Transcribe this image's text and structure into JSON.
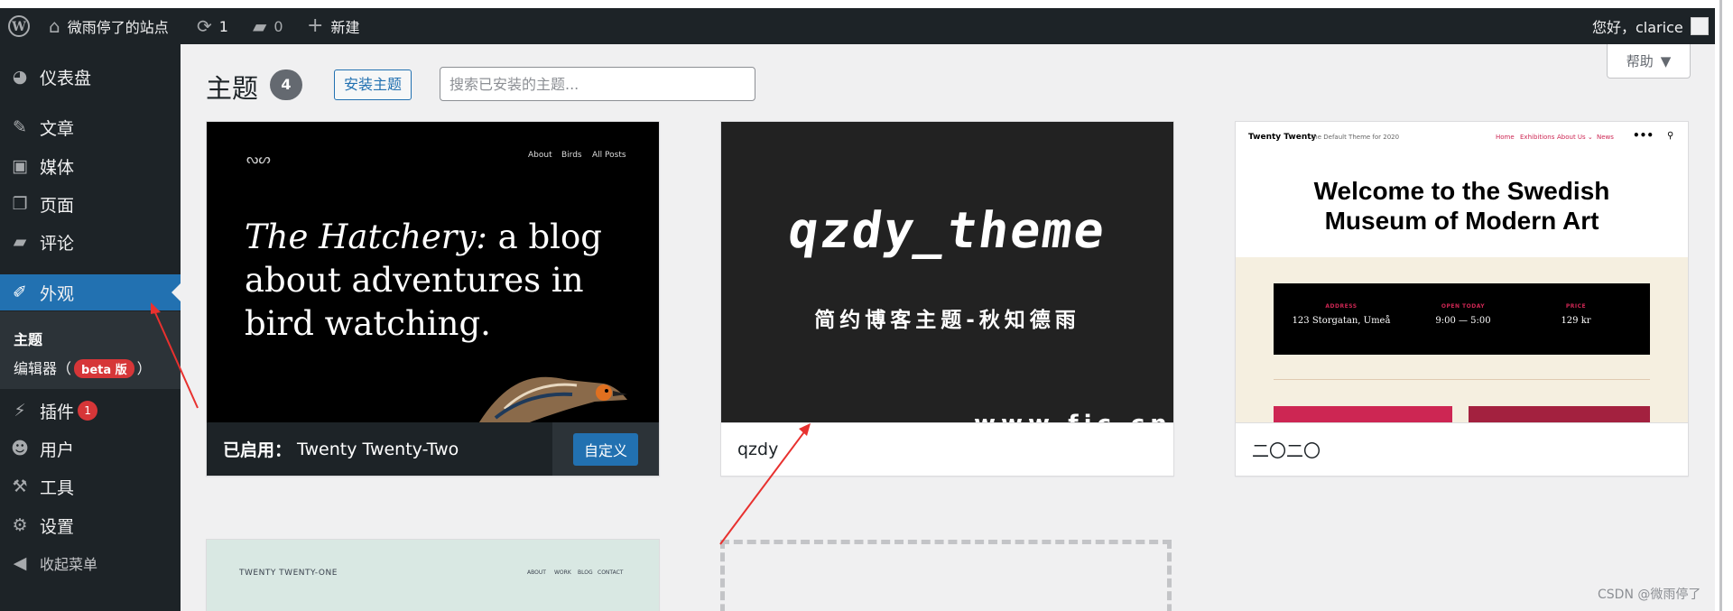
{
  "adminbar": {
    "site_name": "微雨停了的站点",
    "updates_count": "1",
    "comments_count": "0",
    "new_label": "新建",
    "greeting": "您好，clarice"
  },
  "sidebar": {
    "items": [
      {
        "label": "仪表盘",
        "icon": "dashboard-icon"
      },
      {
        "label": "文章",
        "icon": "pin-icon"
      },
      {
        "label": "媒体",
        "icon": "media-icon"
      },
      {
        "label": "页面",
        "icon": "page-icon"
      },
      {
        "label": "评论",
        "icon": "comment-icon"
      },
      {
        "label": "外观",
        "icon": "brush-icon"
      },
      {
        "label": "插件",
        "icon": "plugin-icon",
        "badge": "1"
      },
      {
        "label": "用户",
        "icon": "user-icon"
      },
      {
        "label": "工具",
        "icon": "wrench-icon"
      },
      {
        "label": "设置",
        "icon": "settings-icon"
      },
      {
        "label": "收起菜单",
        "icon": "collapse-icon"
      }
    ],
    "submenu": {
      "themes": "主题",
      "editor": "编辑器（",
      "beta": "beta 版",
      "editor_close": "）"
    }
  },
  "main": {
    "title": "主题",
    "theme_count": "4",
    "install_button": "安装主题",
    "search_placeholder": "搜索已安装的主题...",
    "help_label": "帮助"
  },
  "themes": [
    {
      "active_prefix": "已启用：",
      "name": "Twenty Twenty-Two",
      "customize_label": "自定义",
      "preview": {
        "logo": "ᔓᔕ",
        "nav": [
          "About",
          "Birds",
          "All Posts"
        ],
        "headline_italic": "The Hatchery:",
        "headline_rest": " a blog about adventures in bird watching."
      }
    },
    {
      "name": "qzdy",
      "preview": {
        "title": "qzdy_theme",
        "subtitle": "简约博客主题-秋知德雨",
        "url_fragment": "www.fjc.cn"
      }
    },
    {
      "name": "二〇二〇",
      "preview": {
        "brand": "Twenty Twenty",
        "tagline": "The Default Theme for 2020",
        "nav": [
          "Home",
          "Exhibitions",
          "About Us ⌄",
          "News"
        ],
        "hero_line1": "Welcome to the Swedish",
        "hero_line2": "Museum of Modern Art",
        "info": [
          {
            "label": "ADDRESS",
            "value": "123 Storgatan, Umeå"
          },
          {
            "label": "OPEN TODAY",
            "value": "9:00 — 5:00"
          },
          {
            "label": "PRICE",
            "value": "129 kr"
          }
        ]
      }
    },
    {
      "preview": {
        "brand": "TWENTY TWENTY-ONE",
        "nav": [
          "ABOUT",
          "WORK",
          "BLOG",
          "CONTACT"
        ]
      }
    }
  ],
  "watermark": "CSDN @微雨停了",
  "colors": {
    "admin_dark": "#1d2327",
    "accent_blue": "#2271b1",
    "badge_red": "#d63638",
    "annotation_red": "#e8312f"
  }
}
